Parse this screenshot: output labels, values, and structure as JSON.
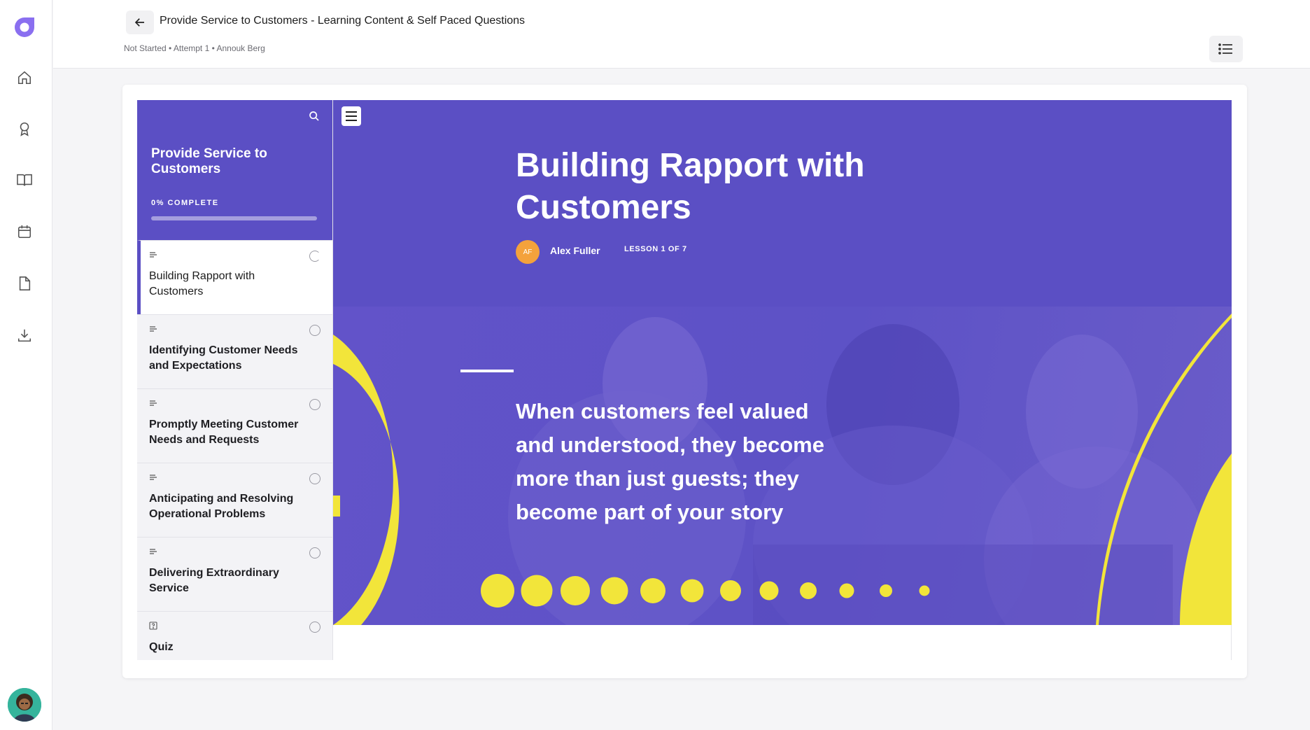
{
  "app": {
    "logo": "brand-logo",
    "nav_icons": [
      "home-icon",
      "award-icon",
      "book-icon",
      "calendar-icon",
      "file-icon",
      "download-icon"
    ],
    "colors": {
      "brand": "#5b4fc4",
      "accent": "#f2e53a",
      "author": "#f4a23c"
    }
  },
  "header": {
    "course_title": "Provide Service to Customers - Learning Content & Self Paced Questions",
    "meta": "Not Started • Attempt 1 • Annouk Berg"
  },
  "course": {
    "title": "Provide Service to Customers",
    "progress_label": "0% COMPLETE",
    "progress": 0,
    "lessons": [
      {
        "name": "Building Rapport with Customers",
        "type_icon": "text-lines-icon"
      },
      {
        "name": "Identifying Customer Needs and Expectations",
        "type_icon": "text-lines-icon"
      },
      {
        "name": "Promptly Meeting Customer Needs and Requests",
        "type_icon": "text-lines-icon"
      },
      {
        "name": "Anticipating and Resolving Operational Problems",
        "type_icon": "text-lines-icon"
      },
      {
        "name": "Delivering Extraordinary Service",
        "type_icon": "text-lines-icon"
      },
      {
        "name": "Quiz",
        "type_icon": "quiz-icon"
      }
    ]
  },
  "lesson": {
    "title": "Building Rapport with Customers",
    "author_initials": "AF",
    "author": "Alex Fuller",
    "count": "LESSON 1 OF 7",
    "quote": "When customers feel valued and understood, they become more than just guests; they become part of your story"
  }
}
